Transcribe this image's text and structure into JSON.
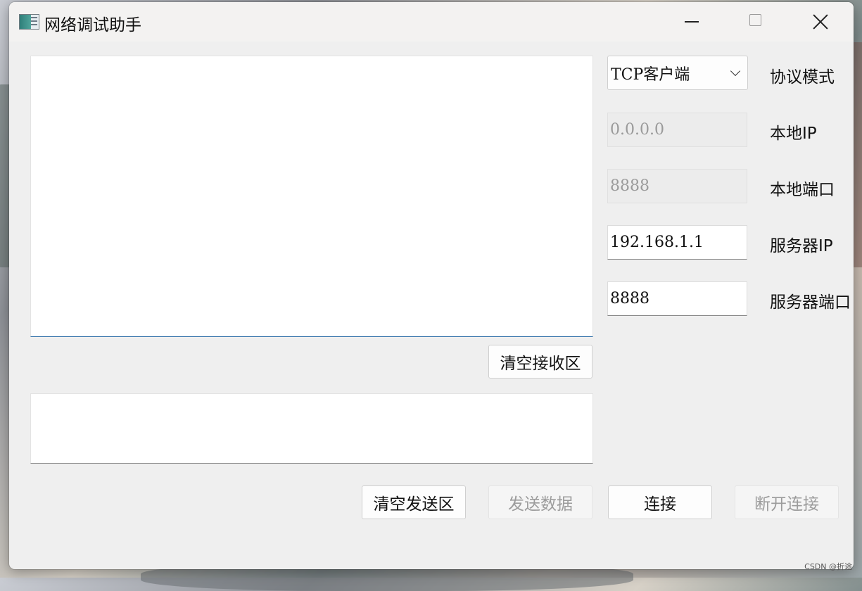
{
  "window": {
    "title": "网络调试助手"
  },
  "buttons": {
    "clear_receive": "清空接收区",
    "clear_send": "清空发送区",
    "send_data": "发送数据",
    "connect": "连接",
    "disconnect": "断开连接"
  },
  "config": {
    "protocol_value": "TCP客户端",
    "protocol_label": "协议模式",
    "local_ip_value": "0.0.0.0",
    "local_ip_label": "本地IP",
    "local_port_value": "8888",
    "local_port_label": "本地端口",
    "server_ip_value": "192.168.1.1",
    "server_ip_label": "服务器IP",
    "server_port_value": "8888",
    "server_port_label": "服务器端口"
  },
  "areas": {
    "receive_text": "",
    "send_text": ""
  },
  "watermark": "CSDN @折途",
  "icons": [
    "app-icon",
    "minimize-icon",
    "maximize-icon",
    "close-icon",
    "chevron-down-icon"
  ]
}
